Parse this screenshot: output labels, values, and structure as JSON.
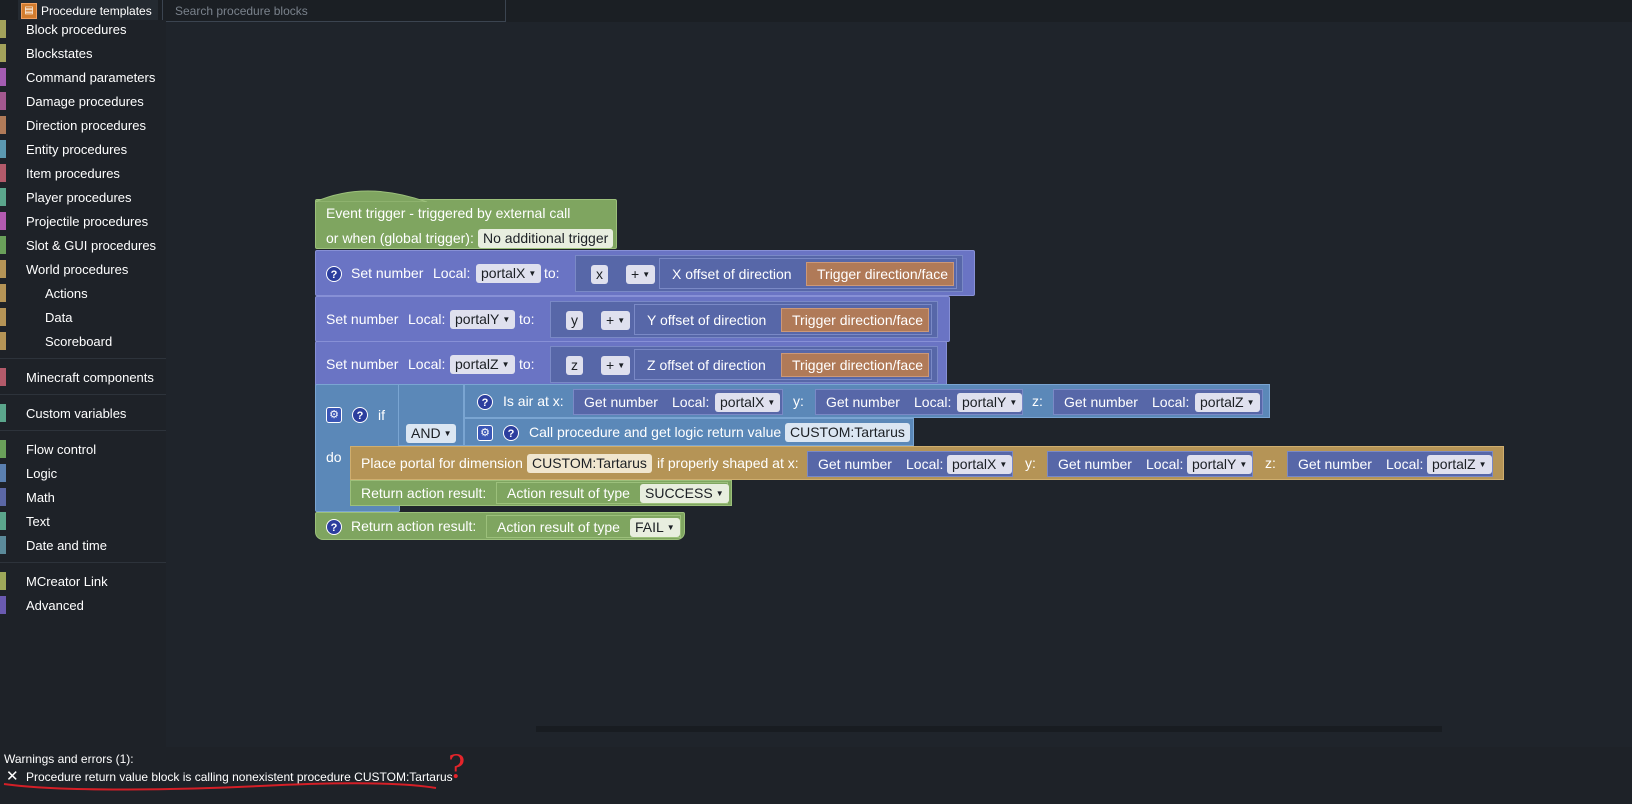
{
  "top_bar": {
    "templates_tab_label": "Procedure templates",
    "search_placeholder": "Search procedure blocks"
  },
  "sidebar": {
    "categories": [
      {
        "label": "Block procedures",
        "color": "#a3a25b"
      },
      {
        "label": "Blockstates",
        "color": "#a3a25b"
      },
      {
        "label": "Command parameters",
        "color": "#a45cb2"
      },
      {
        "label": "Damage procedures",
        "color": "#a3588f"
      },
      {
        "label": "Direction procedures",
        "color": "#b07a58"
      },
      {
        "label": "Entity procedures",
        "color": "#5b98b0"
      },
      {
        "label": "Item procedures",
        "color": "#b35a6a"
      },
      {
        "label": "Player procedures",
        "color": "#5ba68c"
      },
      {
        "label": "Projectile procedures",
        "color": "#b35ab0"
      },
      {
        "label": "Slot & GUI procedures",
        "color": "#6aa05a"
      },
      {
        "label": "World procedures",
        "color": "#b59456"
      },
      {
        "label": "Actions",
        "color": "#b59456"
      },
      {
        "label": "Data",
        "color": "#b59456"
      },
      {
        "label": "Scoreboard",
        "color": "#b59456"
      },
      {
        "label": "Minecraft components",
        "color": "#b35a6a"
      },
      {
        "label": "Custom variables",
        "color": "#5ba68c"
      },
      {
        "label": "Flow control",
        "color": "#6aa05a"
      },
      {
        "label": "Logic",
        "color": "#5b80b0"
      },
      {
        "label": "Math",
        "color": "#5b67a5"
      },
      {
        "label": "Text",
        "color": "#5ba68c"
      },
      {
        "label": "Date and time",
        "color": "#5b8a9a"
      },
      {
        "label": "MCreator Link",
        "color": "#9ea85a"
      },
      {
        "label": "Advanced",
        "color": "#6a5ab0"
      }
    ]
  },
  "blocks": {
    "event": {
      "line1": "Event trigger - triggered by external call",
      "line2": "or when (global trigger):",
      "trigger_value": "No additional trigger"
    },
    "common": {
      "set_number": "Set number",
      "local": "Local:",
      "to": "to:",
      "plus": "+",
      "get_number": "Get number",
      "trigger_direction": "Trigger direction/face",
      "y_label": "y:",
      "z_label": "z:",
      "help": "?",
      "gear": "⚙",
      "dropdown": "▼"
    },
    "set_x": {
      "var": "portalX",
      "operand": "x",
      "offset": "X offset of direction"
    },
    "set_y": {
      "var": "portalY",
      "operand": "y",
      "offset": "Y offset of direction"
    },
    "set_z": {
      "var": "portalZ",
      "operand": "z",
      "offset": "Z offset of direction"
    },
    "if_block": {
      "if_label": "if",
      "do_label": "do",
      "and_label": "AND",
      "is_air": "Is air at x:",
      "call_proc": "Call procedure and get logic return value",
      "call_proc_value": "CUSTOM:Tartarus",
      "place_portal": "Place portal for dimension",
      "place_portal_dim": "CUSTOM:Tartarus",
      "properly_shaped": "if properly shaped at x:",
      "return_label": "Return action result:",
      "action_result": "Action result of type",
      "success": "SUCCESS"
    },
    "final_return": {
      "label": "Return action result:",
      "action_result": "Action result of type",
      "fail": "FAIL"
    },
    "vars": {
      "x": "portalX",
      "y": "portalY",
      "z": "portalZ"
    }
  },
  "warnings": {
    "title": "Warnings and errors (1):",
    "close_glyph": "✕",
    "message": "Procedure return value block is calling nonexistent procedure CUSTOM:Tartarus",
    "annotation": "?"
  }
}
